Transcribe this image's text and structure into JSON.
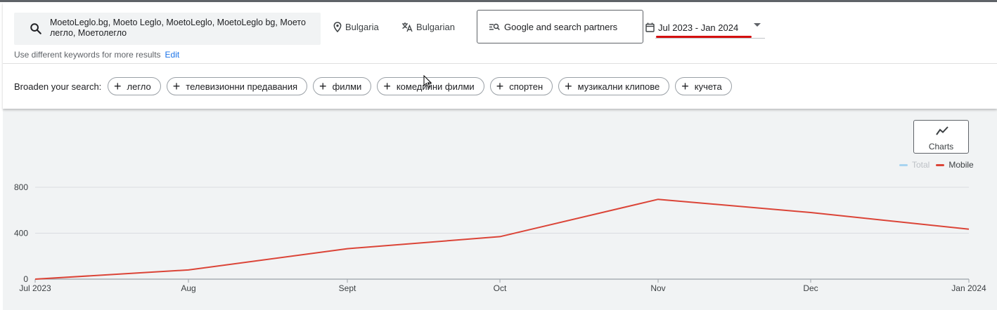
{
  "keywords": {
    "text": "MoetoLeglo.bg, Moeto Leglo, MoetoLeglo, MoetoLeglo bg, Моето легло, Моетолегло",
    "hint": "Use different keywords for more results",
    "edit_label": "Edit"
  },
  "location": {
    "label": "Bulgaria",
    "icon": "location-pin-icon"
  },
  "language": {
    "label": "Bulgarian",
    "icon": "translate-icon"
  },
  "network": {
    "label": "Google and search partners",
    "icon": "search-network-icon"
  },
  "date_range": {
    "label": "Jul 2023 - Jan 2024",
    "icon": "calendar-icon"
  },
  "broaden": {
    "label": "Broaden your search:",
    "chips": [
      "легло",
      "телевизионни предавания",
      "филми",
      "комедийни филми",
      "спортен",
      "музикални клипове",
      "кучета"
    ]
  },
  "charts_button": {
    "label": "Charts",
    "icon": "chart-line-icon"
  },
  "legend": [
    {
      "label": "Total",
      "color": "#a8d4f0",
      "active": false
    },
    {
      "label": "Mobile",
      "color": "#db4437",
      "active": true
    }
  ],
  "chart_data": {
    "type": "line",
    "categories": [
      "Jul 2023",
      "Aug",
      "Sept",
      "Oct",
      "Nov",
      "Dec",
      "Jan 2024"
    ],
    "series": [
      {
        "name": "Mobile",
        "color": "#db4437",
        "values": [
          0,
          80,
          265,
          370,
          695,
          580,
          435
        ]
      }
    ],
    "y_ticks": [
      0,
      400,
      800
    ],
    "ylim": [
      0,
      800
    ],
    "grid": true,
    "legend_position": "top-right"
  }
}
